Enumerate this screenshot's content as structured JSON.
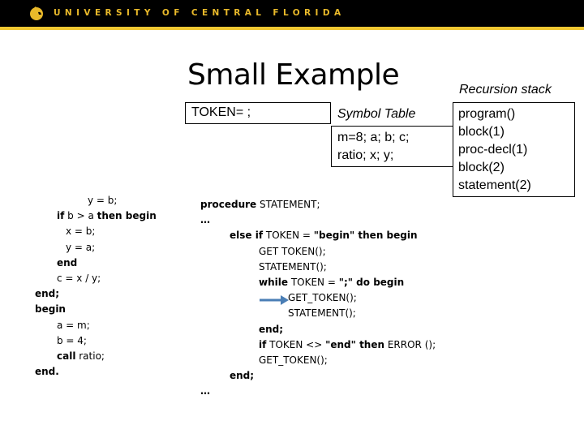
{
  "header": {
    "brand": "UNIVERSITY OF CENTRAL FLORIDA",
    "logo_icon": "pegasus-logo-icon",
    "colors": {
      "background": "#000000",
      "gold": "#f2c832",
      "text": "#e9b92a"
    }
  },
  "slide": {
    "title": "Small Example",
    "token_label": "TOKEN= ;",
    "symbol_table": {
      "label": "Symbol Table",
      "lines": [
        "m=8; a; b; c;",
        "ratio; x; y;"
      ]
    },
    "recursion_stack": {
      "label": "Recursion stack",
      "items": [
        "program()",
        "block(1)",
        "proc-decl(1)",
        "block(2)",
        "statement(2)"
      ]
    },
    "left_code": [
      [
        {
          "t": "y = b;",
          "b": false
        }
      ],
      [
        {
          "t": "if",
          "b": true
        },
        {
          "t": " b > a ",
          "b": false
        },
        {
          "t": "then begin",
          "b": true
        }
      ],
      [
        {
          "t": "x = b;",
          "b": false
        }
      ],
      [
        {
          "t": "y = a;",
          "b": false
        }
      ],
      [
        {
          "t": "end",
          "b": true
        }
      ],
      [
        {
          "t": "c = x / y;",
          "b": false
        }
      ],
      [
        {
          "t": "end;",
          "b": true
        }
      ],
      [
        {
          "t": "begin",
          "b": true
        }
      ],
      [
        {
          "t": "a = m;",
          "b": false
        }
      ],
      [
        {
          "t": "b = 4;",
          "b": false
        }
      ],
      [
        {
          "t": "call",
          "b": true
        },
        {
          "t": " ratio;",
          "b": false
        }
      ],
      [
        {
          "t": "end.",
          "b": true
        }
      ]
    ],
    "right_code": [
      [
        {
          "t": "procedure",
          "b": true
        },
        {
          "t": " STATEMENT;",
          "b": false
        }
      ],
      [
        {
          "t": "…",
          "b": true
        }
      ],
      [
        {
          "t": "else if",
          "b": true
        },
        {
          "t": " TOKEN = ",
          "b": false
        },
        {
          "t": "\"begin\" then begin",
          "b": true
        }
      ],
      [
        {
          "t": "GET TOKEN();",
          "b": false
        }
      ],
      [
        {
          "t": "STATEMENT();",
          "b": false
        }
      ],
      [
        {
          "t": "while",
          "b": true
        },
        {
          "t": " TOKEN = ",
          "b": false
        },
        {
          "t": "\";\" do begin",
          "b": true
        }
      ],
      [
        {
          "t": "GET_TOKEN();",
          "b": false
        }
      ],
      [
        {
          "t": "STATEMENT();",
          "b": false
        }
      ],
      [
        {
          "t": "end;",
          "b": true
        }
      ],
      [
        {
          "t": "if",
          "b": true
        },
        {
          "t": " TOKEN <> ",
          "b": false
        },
        {
          "t": "\"end\" then",
          "b": true
        },
        {
          "t": " ERROR ();",
          "b": false
        }
      ],
      [
        {
          "t": "GET_TOKEN();",
          "b": false
        }
      ],
      [
        {
          "t": "end;",
          "b": true
        }
      ],
      [
        {
          "t": "…",
          "b": true
        }
      ]
    ],
    "arrow": {
      "icon": "arrow-right-icon",
      "color": "#4a7eb5",
      "points_to": "GET_TOKEN();"
    }
  }
}
